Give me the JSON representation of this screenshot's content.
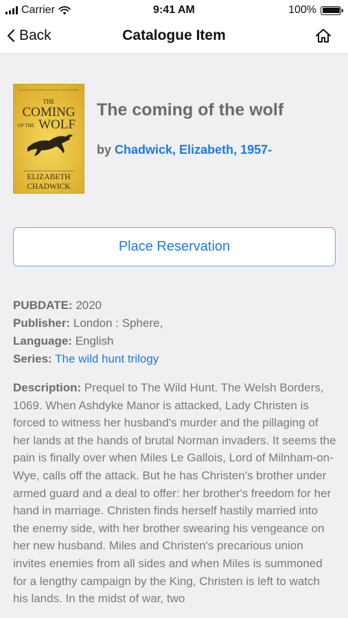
{
  "status_bar": {
    "carrier": "Carrier",
    "time": "9:41 AM",
    "battery": "100%"
  },
  "nav": {
    "back_label": "Back",
    "title": "Catalogue Item"
  },
  "book": {
    "title": "The coming of the wolf",
    "by_label": "by",
    "author": "Chadwick, Elizabeth, 1957-",
    "cover": {
      "tagline": "The prequel to the bestselling and beloved novel The Wild Hunt",
      "title_line1": "THE",
      "title_line2": "COMING",
      "title_line3": "OF THE",
      "title_line4": "WOLF",
      "author_line1": "ELIZABETH",
      "author_line2": "CHADWICK"
    }
  },
  "reserve_label": "Place Reservation",
  "meta": {
    "pubdate_label": "PUBDATE:",
    "pubdate": "2020",
    "publisher_label": "Publisher:",
    "publisher": "London : Sphere,",
    "language_label": "Language:",
    "language": "English",
    "series_label": "Series:",
    "series": "The wild hunt trilogy"
  },
  "description": {
    "label": "Description:",
    "text": "Prequel to The Wild Hunt. The Welsh Borders, 1069. When Ashdyke Manor is attacked, Lady Christen is forced to witness her husband's murder and the pillaging of her lands at the hands of brutal Norman invaders. It seems the pain is finally over when Miles Le Gallois, Lord of Milnham-on-Wye, calls off the attack. But he has Christen's brother under armed guard and a deal to offer: her brother's freedom for her hand in marriage. Christen finds herself hastily married into the enemy side, with her brother swearing his vengeance on her new husband. Miles and Christen's precarious union invites enemies from all sides and when Miles is summoned for a lengthy campaign by the King, Christen is left to watch his lands. In the midst of war, two"
  }
}
